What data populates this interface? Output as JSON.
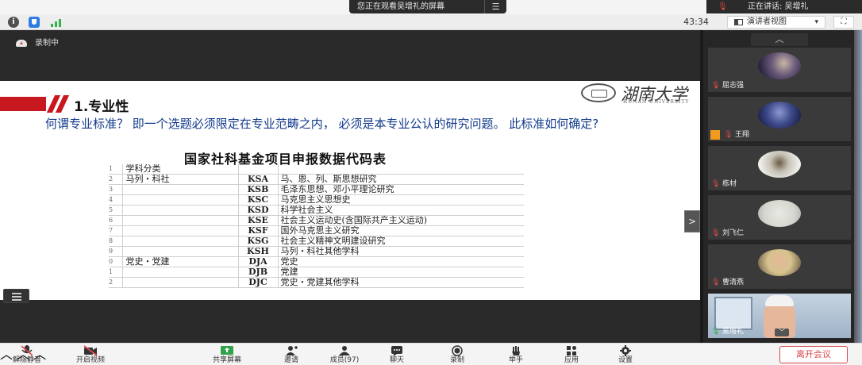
{
  "top": {
    "share_notice": "您正在观看吴增礼的屏幕",
    "share_menu": "☰",
    "speaking": "正在讲话: 吴增礼"
  },
  "infobar": {
    "timer": "43:34",
    "view_mode": "演讲者视图",
    "caret": "▾",
    "fullscreen": "⛶"
  },
  "share": {
    "recording": "录制中",
    "expand": ">"
  },
  "slide": {
    "section_title": "1.专业性",
    "university_cn": "湖南大学",
    "university_en": "HUNAN UNIVERSITY",
    "question": "何谓专业标准？ 即一个选题必须限定在专业范畴之内， 必须是本专业公认的研究问题。 此标准如何确定?",
    "table_title": "国家社科基金项目申报数据代码表",
    "rows": [
      {
        "idx": "1",
        "cat": "学科分类",
        "code": "",
        "name": ""
      },
      {
        "idx": "2",
        "cat": "马列・科社",
        "code": "KSA",
        "name": "马、恩、列、斯思想研究"
      },
      {
        "idx": "3",
        "cat": "",
        "code": "KSB",
        "name": "毛泽东思想、邓小平理论研究"
      },
      {
        "idx": "4",
        "cat": "",
        "code": "KSC",
        "name": "马克思主义思想史"
      },
      {
        "idx": "5",
        "cat": "",
        "code": "KSD",
        "name": "科学社会主义"
      },
      {
        "idx": "6",
        "cat": "",
        "code": "KSE",
        "name": "社会主义运动史(含国际共产主义运动)"
      },
      {
        "idx": "7",
        "cat": "",
        "code": "KSF",
        "name": "国外马克思主义研究"
      },
      {
        "idx": "8",
        "cat": "",
        "code": "KSG",
        "name": "社会主义精神文明建设研究"
      },
      {
        "idx": "9",
        "cat": "",
        "code": "KSH",
        "name": "马列・科社其他学科"
      },
      {
        "idx": "0",
        "cat": "党史・党建",
        "code": "DJA",
        "name": "党史"
      },
      {
        "idx": "1",
        "cat": "",
        "code": "DJB",
        "name": "党建"
      },
      {
        "idx": "2",
        "cat": "",
        "code": "DJC",
        "name": "党史・党建其他学科"
      }
    ]
  },
  "participants": [
    {
      "name": "屈志强"
    },
    {
      "name": "王翔"
    },
    {
      "name": "栋材"
    },
    {
      "name": "刘飞仁"
    },
    {
      "name": "曹清燕"
    },
    {
      "name": "吴增礼"
    }
  ],
  "panel": {
    "scroll_up": "︿",
    "video_collapse": "﹀"
  },
  "toolbar": {
    "unmute": "解除静音",
    "start_video": "开启视频",
    "share_screen": "共享屏幕",
    "invite": "邀请",
    "members": "成员(97)",
    "chat": "聊天",
    "record": "录制",
    "raise_hand": "举手",
    "apps": "应用",
    "settings": "设置",
    "leave": "离开会议",
    "chevron": "︿"
  },
  "colors": {
    "accent_red": "#c8181f",
    "question_blue": "#123a8c",
    "leave_red": "#d94a4a",
    "host_orange": "#f29a1f"
  }
}
